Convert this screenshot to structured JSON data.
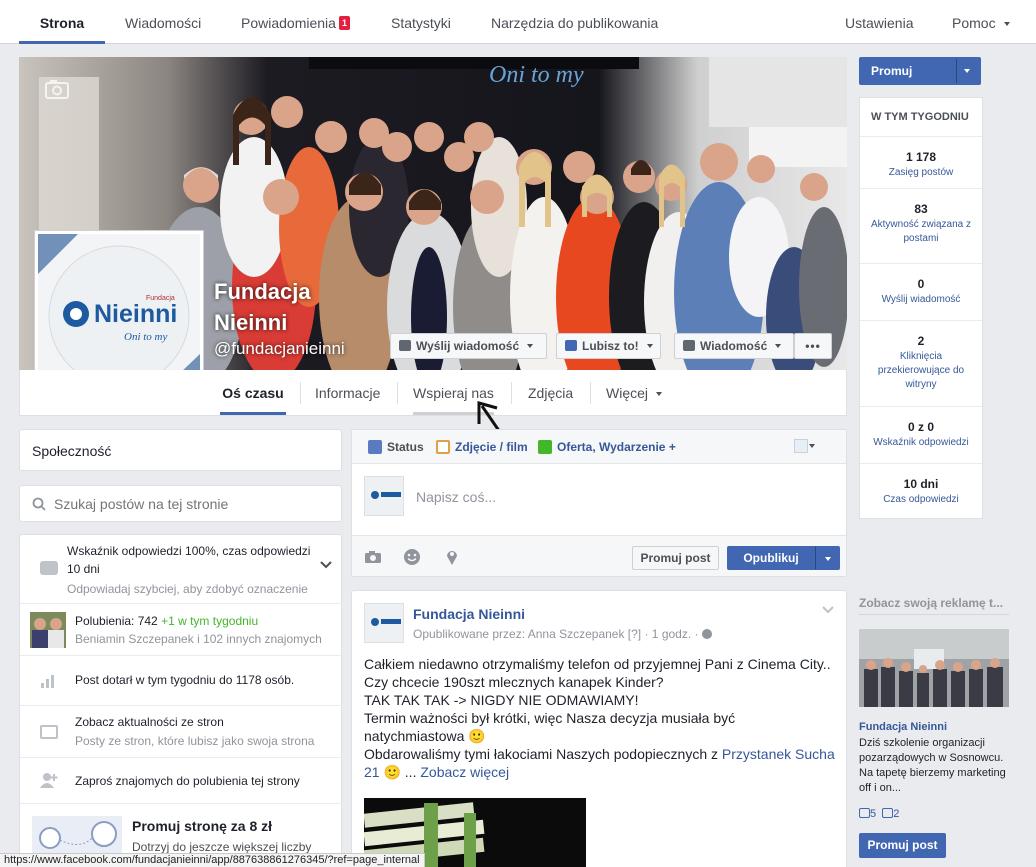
{
  "topnav": {
    "tabs": [
      {
        "label": "Strona",
        "active": true
      },
      {
        "label": "Wiadomości"
      },
      {
        "label": "Powiadomienia",
        "badge": "1"
      },
      {
        "label": "Statystyki"
      },
      {
        "label": "Narzędzia do publikowania"
      }
    ],
    "settings": "Ustawienia",
    "help": "Pomoc"
  },
  "cover": {
    "banner_text": "Oni to my",
    "page_name_line1": "Fundacja",
    "page_name_line2": "Nieinni",
    "handle": "@fundacjanieinni",
    "buttons": {
      "send_message": "Wyślij wiadomość",
      "like": "Lubisz to!",
      "message": "Wiadomość",
      "more": "•••"
    }
  },
  "profile_logo": {
    "brand": "Nieinni",
    "sub": "Oni to my",
    "small": "Fundacja"
  },
  "page_tabs": [
    "Oś czasu",
    "Informacje",
    "Wspieraj nas",
    "Zdjęcia",
    "Więcej"
  ],
  "left": {
    "community": "Społeczność",
    "search_placeholder": "Szukaj postów na tej stronie",
    "rows": [
      {
        "title": "Wskaźnik odpowiedzi 100%, czas odpowiedzi",
        "title2": "10 dni",
        "sub": "Odpowiadaj szybciej, aby zdobyć oznaczenie"
      },
      {
        "title": "Polubienia: 742",
        "highlight": "+1 w tym tygodniu",
        "sub": "Beniamin Szczepanek i 102 innych znajomych"
      },
      {
        "title": "Post dotarł w tym tygodniu do 1178 osób."
      },
      {
        "title": "Zobacz aktualności ze stron",
        "sub": "Posty ze stron, które lubisz jako swoja strona"
      },
      {
        "title": "Zaproś znajomych do polubienia tej strony"
      }
    ],
    "promo": {
      "title": "Promuj stronę za 8 zł",
      "sub": "Dotrzyj do jeszcze większej liczby"
    }
  },
  "composer": {
    "tabs": [
      "Status",
      "Zdjęcie / film",
      "Oferta, Wydarzenie +"
    ],
    "placeholder": "Napisz coś...",
    "promote_button": "Promuj post",
    "publish_button": "Opublikuj"
  },
  "post": {
    "author": "Fundacja Nieinni",
    "meta": "Opublikowane przez: Anna Szczepanek [?] · 1 godz. ·",
    "lines": [
      "Całkiem niedawno otrzymaliśmy telefon od przyjemnej Pani z Cinema City..",
      "Czy chcecie 190szt mlecznych kanapek Kinder?",
      "TAK TAK TAK -> NIGDY NIE ODMAWIAMY!",
      "Termin ważności był krótki, więc Nasza decyzja musiała być",
      "natychmiastowa 🙂",
      "Obdarowaliśmy tymi łakociami Naszych podopiecznych z"
    ],
    "link": "Przystanek Sucha",
    "link2": "21",
    "emoji": "🙂",
    "ellipsis": "...",
    "see_more": "Zobacz więcej"
  },
  "right": {
    "promote_button": "Promuj",
    "week_title": "W TYM TYGODNIU",
    "stats": [
      {
        "n": "1 178",
        "l": "Zasięg postów"
      },
      {
        "n": "83",
        "l": "Aktywność związana z postami"
      },
      {
        "n": "0",
        "l": "Wyślij wiadomość"
      },
      {
        "n": "2",
        "l": "Kliknięcia przekierowujące do witryny"
      },
      {
        "n": "0 z 0",
        "l": "Wskaźnik odpowiedzi"
      },
      {
        "n": "10 dni",
        "l": "Czas odpowiedzi"
      }
    ],
    "ad": {
      "heading": "Zobacz swoją reklamę t...",
      "page": "Fundacja Nieinni",
      "text": "Dziś szkolenie organizacji pozarządowych w Sosnowcu. Na tapetę bierzemy marketing off i on...",
      "likes": "5",
      "comments": "2",
      "button": "Promuj post"
    }
  },
  "statusbar": "https://www.facebook.com/fundacjanieinni/app/887638861276345/?ref=page_internal",
  "colors": {
    "accent": "#4267b2",
    "link": "#365899",
    "badge": "#e41e3f",
    "green": "#42b72a"
  }
}
